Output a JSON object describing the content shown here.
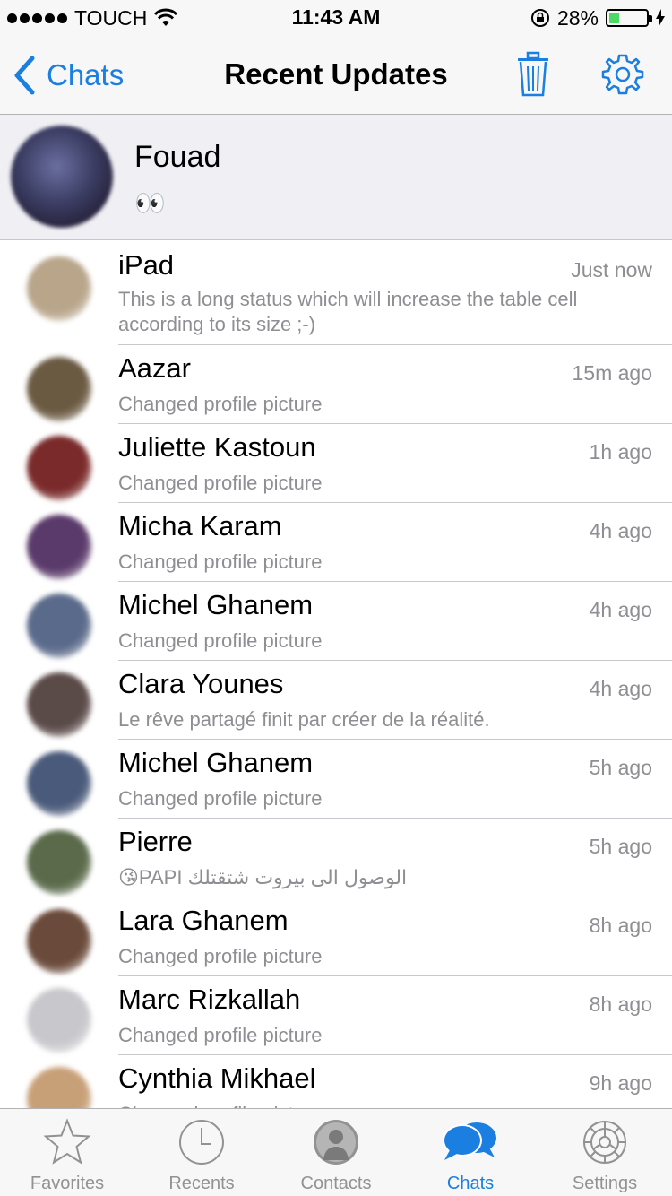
{
  "status_bar": {
    "carrier": "TOUCH",
    "time": "11:43 AM",
    "battery": "28%",
    "battery_level": 0.28
  },
  "nav": {
    "back_label": "Chats",
    "title": "Recent Updates",
    "trash_icon": "trash-icon",
    "settings_icon": "gear-icon"
  },
  "me": {
    "name": "Fouad",
    "status": "👀"
  },
  "updates": [
    {
      "name": "iPad",
      "time": "Just now",
      "status": "This is a long status which will increase the table cell according to its size ;-)",
      "color": "#b8a58a"
    },
    {
      "name": "Aazar",
      "time": "15m ago",
      "status": "Changed profile picture",
      "color": "#6b5a42"
    },
    {
      "name": "Juliette Kastoun",
      "time": "1h ago",
      "status": "Changed profile picture",
      "color": "#7a2a2a"
    },
    {
      "name": "Micha Karam",
      "time": "4h ago",
      "status": "Changed profile picture",
      "color": "#5a3a6a"
    },
    {
      "name": "Michel Ghanem",
      "time": "4h ago",
      "status": "Changed profile picture",
      "color": "#5a6a8a"
    },
    {
      "name": "Clara Younes",
      "time": "4h ago",
      "status": "Le rêve partagé finit par créer de la réalité.",
      "color": "#5a4a48"
    },
    {
      "name": "Michel Ghanem",
      "time": "5h ago",
      "status": "Changed profile picture",
      "color": "#4a5a7a"
    },
    {
      "name": "Pierre",
      "time": "5h ago",
      "status": "😘PAPI الوصول الى بيروت شتقتلك",
      "color": "#5a6a4a"
    },
    {
      "name": "Lara Ghanem",
      "time": "8h ago",
      "status": "Changed profile picture",
      "color": "#6a4a3a"
    },
    {
      "name": "Marc Rizkallah",
      "time": "8h ago",
      "status": "Changed profile picture",
      "color": "#c8c8cc"
    },
    {
      "name": "Cynthia Mikhael",
      "time": "9h ago",
      "status": "Changed profile picture",
      "color": "#c8a078"
    }
  ],
  "tabs": [
    {
      "label": "Favorites",
      "icon": "star-icon"
    },
    {
      "label": "Recents",
      "icon": "clock-icon"
    },
    {
      "label": "Contacts",
      "icon": "person-icon"
    },
    {
      "label": "Chats",
      "icon": "chat-bubbles-icon",
      "active": true
    },
    {
      "label": "Settings",
      "icon": "gear-icon"
    }
  ],
  "colors": {
    "accent": "#1a7fe0",
    "battery": "#4cd964"
  }
}
